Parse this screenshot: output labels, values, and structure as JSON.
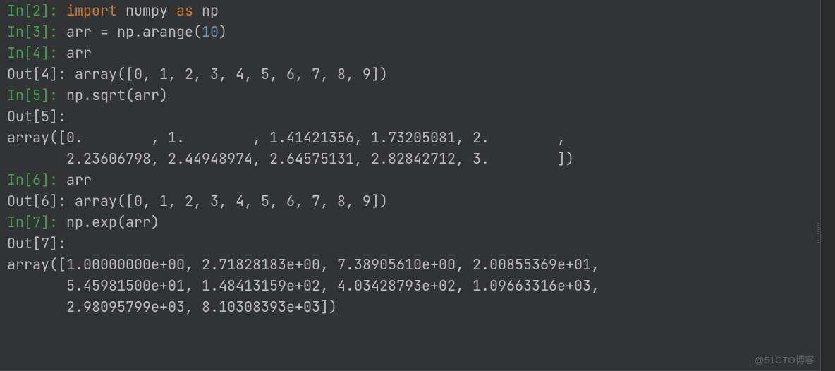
{
  "lines": [
    {
      "in": "In[2]: ",
      "code_parts": [
        "import",
        " numpy ",
        "as",
        " np"
      ],
      "code_classes": [
        "kw",
        "op",
        "kw",
        "op"
      ]
    },
    {
      "in": "In[3]: ",
      "code_parts": [
        "arr = np.arange(",
        "10",
        ")"
      ],
      "code_classes": [
        "op",
        "num",
        "op"
      ]
    },
    {
      "in": "In[4]: ",
      "code_parts": [
        "arr"
      ],
      "code_classes": [
        "op"
      ]
    },
    {
      "out": "Out[4]: array([0, 1, 2, 3, 4, 5, 6, 7, 8, 9])"
    },
    {
      "in": "In[5]: ",
      "code_parts": [
        "np.sqrt(arr)"
      ],
      "code_classes": [
        "op"
      ]
    },
    {
      "out": "Out[5]: "
    },
    {
      "out": "array([0.        , 1.        , 1.41421356, 1.73205081, 2.        ,"
    },
    {
      "out": "       2.23606798, 2.44948974, 2.64575131, 2.82842712, 3.        ])"
    },
    {
      "in": "In[6]: ",
      "code_parts": [
        "arr"
      ],
      "code_classes": [
        "op"
      ]
    },
    {
      "out": "Out[6]: array([0, 1, 2, 3, 4, 5, 6, 7, 8, 9])"
    },
    {
      "in": "In[7]: ",
      "code_parts": [
        "np.exp(arr)"
      ],
      "code_classes": [
        "op"
      ]
    },
    {
      "out": "Out[7]: "
    },
    {
      "out": "array([1.00000000e+00, 2.71828183e+00, 7.38905610e+00, 2.00855369e+01,"
    },
    {
      "out": "       5.45981500e+01, 1.48413159e+02, 4.03428793e+02, 1.09663316e+03,"
    },
    {
      "out": "       2.98095799e+03, 8.10308393e+03])"
    }
  ],
  "watermark": "@51CTO博客"
}
